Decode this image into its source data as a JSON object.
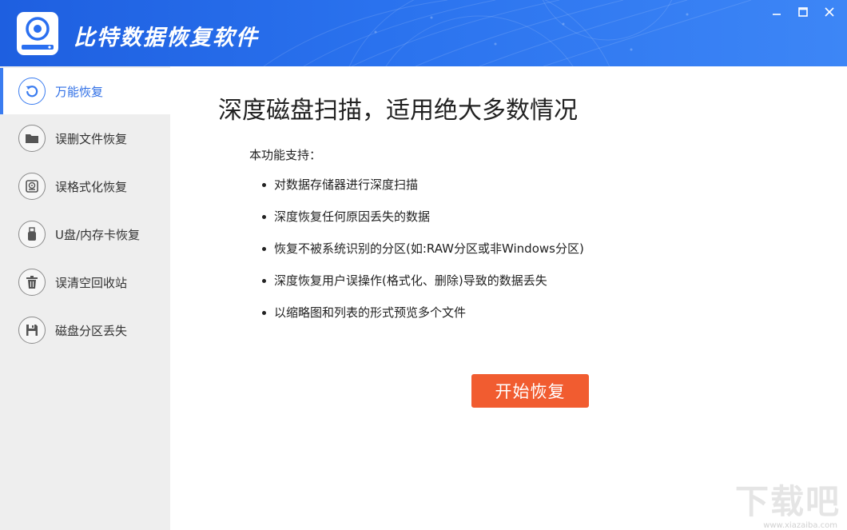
{
  "header": {
    "app_title": "比特数据恢复软件",
    "window_controls": [
      "minimize-icon",
      "maximize-icon",
      "close-icon"
    ]
  },
  "sidebar": {
    "items": [
      {
        "label": "万能恢复",
        "icon": "refresh-icon",
        "active": true
      },
      {
        "label": "误删文件恢复",
        "icon": "folder-icon",
        "active": false
      },
      {
        "label": "误格式化恢复",
        "icon": "disk-icon",
        "active": false
      },
      {
        "label": "U盘/内存卡恢复",
        "icon": "usb-icon",
        "active": false
      },
      {
        "label": "误清空回收站",
        "icon": "trash-icon",
        "active": false
      },
      {
        "label": "磁盘分区丢失",
        "icon": "floppy-icon",
        "active": false
      }
    ]
  },
  "main": {
    "title": "深度磁盘扫描，适用绝大多数情况",
    "support_label": "本功能支持：",
    "features": [
      "对数据存储器进行深度扫描",
      "深度恢复任何原因丢失的数据",
      "恢复不被系统识别的分区(如:RAW分区或非Windows分区)",
      "深度恢复用户误操作(格式化、删除)导致的数据丢失",
      "以缩略图和列表的形式预览多个文件"
    ],
    "start_button": "开始恢复"
  },
  "watermark": {
    "text": "下载吧",
    "sub": "www.xiazaiba.com"
  },
  "colors": {
    "header_blue": "#2a6ff0",
    "accent_blue": "#3a7cf0",
    "start_button": "#f15c30",
    "sidebar_bg": "#eeeeee"
  }
}
